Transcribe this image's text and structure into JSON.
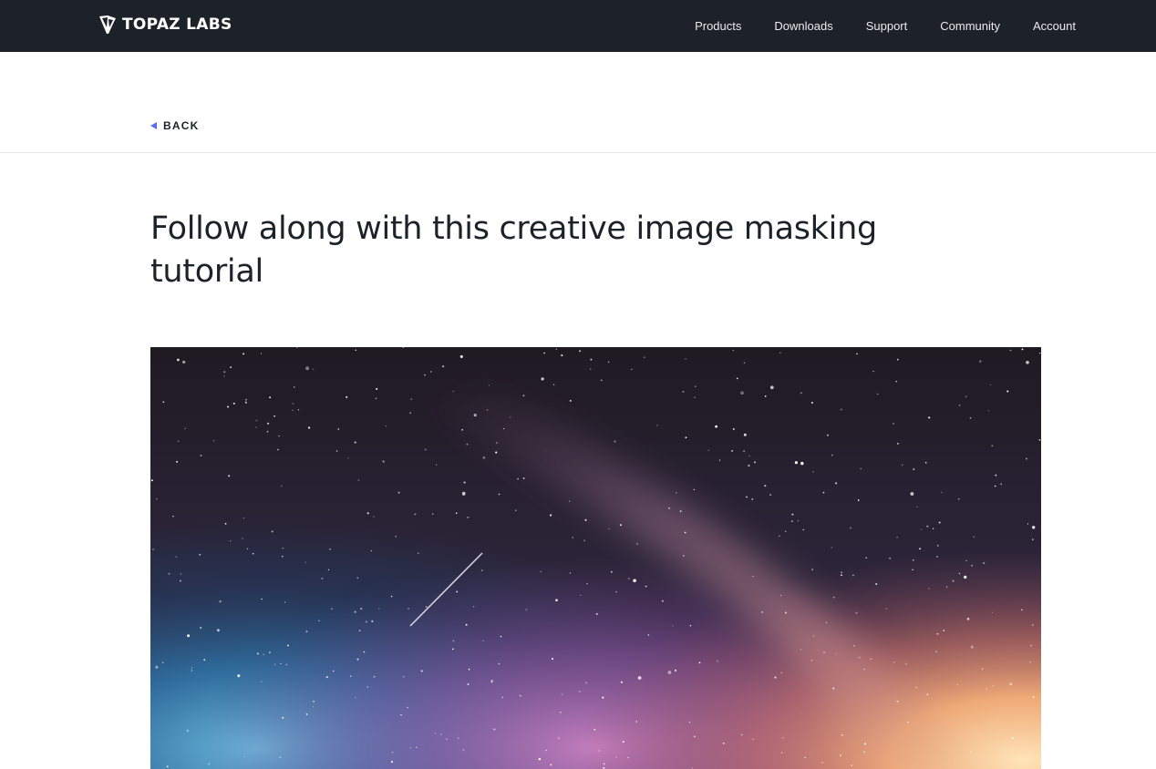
{
  "brand": {
    "name": "TOPAZ LABS",
    "logo_icon": "topaz-diamond-icon"
  },
  "nav": {
    "items": [
      {
        "label": "Products"
      },
      {
        "label": "Downloads"
      },
      {
        "label": "Support"
      },
      {
        "label": "Community"
      },
      {
        "label": "Account"
      }
    ]
  },
  "back": {
    "label": "BACK",
    "icon": "triangle-left-icon",
    "accent_color": "#5b6ef0"
  },
  "article": {
    "title": "Follow along with this creative image masking tutorial"
  },
  "hero": {
    "image": "milky-way-night-sky-photo"
  },
  "colors": {
    "nav_background": "#1d2128",
    "text": "#1d2128"
  }
}
